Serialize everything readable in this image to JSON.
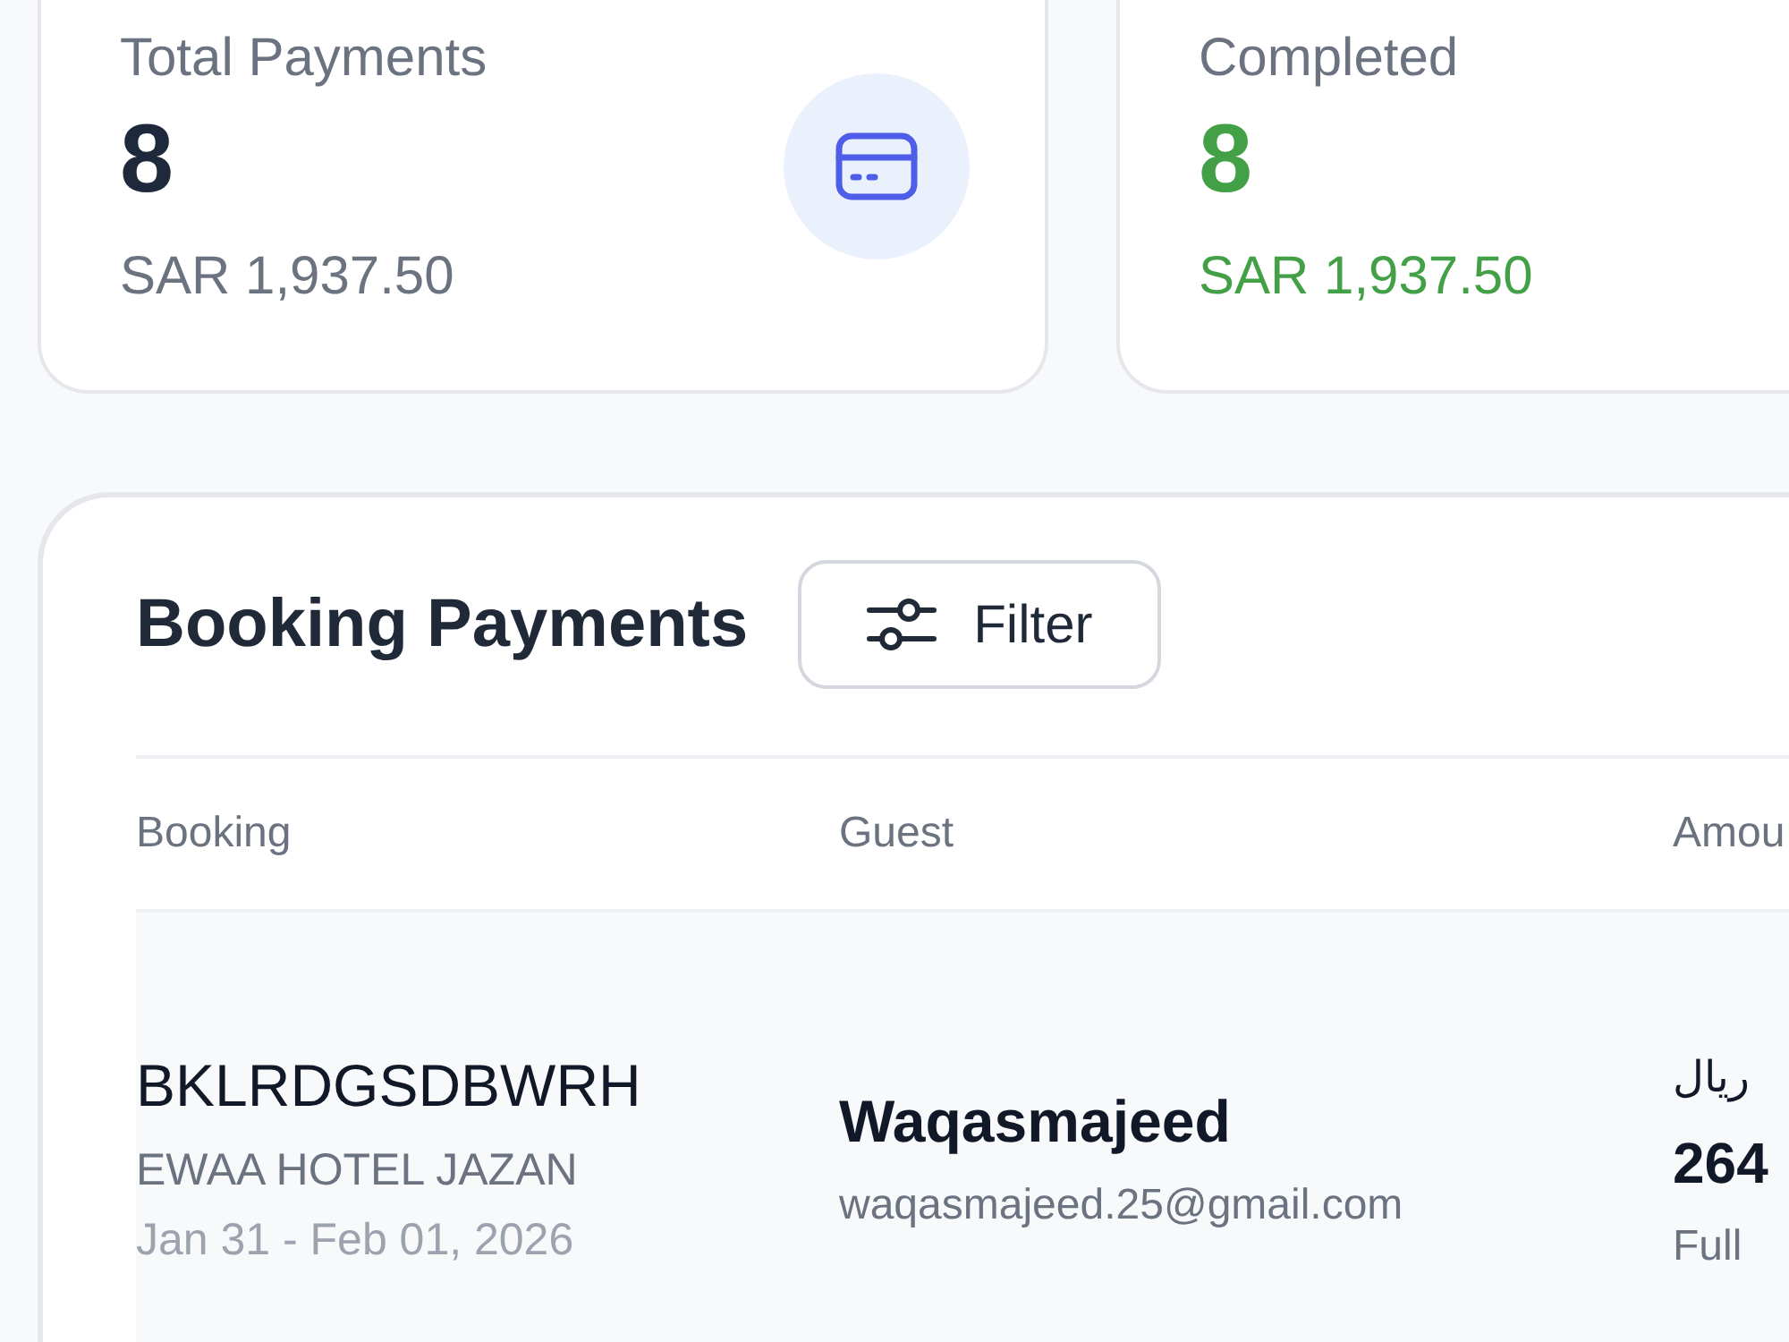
{
  "stat_cards": [
    {
      "kind": "total",
      "label": "Total Payments",
      "count": "8",
      "amount": "SAR 1,937.50"
    },
    {
      "kind": "completed",
      "label": "Completed",
      "count": "8",
      "amount": "SAR 1,937.50"
    }
  ],
  "payments": {
    "title": "Booking Payments",
    "filter_button": "Filter",
    "columns": [
      "Booking",
      "Guest",
      "Amou"
    ],
    "rows": [
      {
        "booking_code": "BKLRDGSDBWRH",
        "hotel": "EWAA HOTEL JAZAN",
        "dates": "Jan 31 - Feb 01, 2026",
        "guest_name": "Waqasmajeed",
        "guest_email": "waqasmajeed.25@gmail.com",
        "currency": "ريال",
        "amount": "264",
        "payment_type": "Full"
      }
    ]
  }
}
